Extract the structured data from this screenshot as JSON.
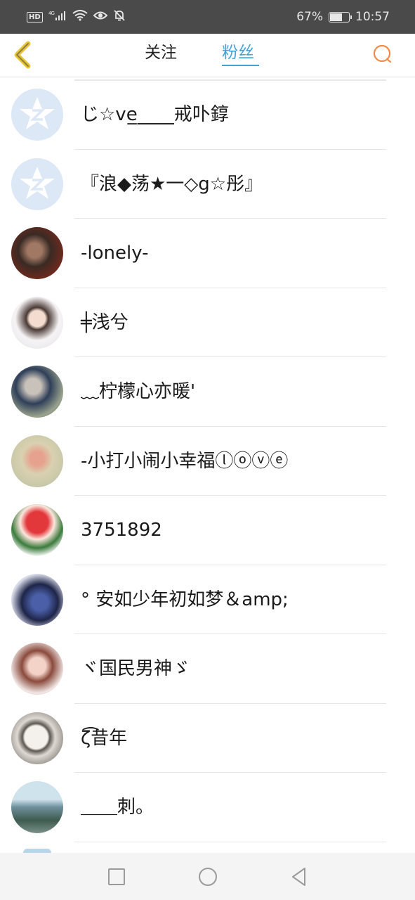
{
  "status_bar": {
    "hd": "HD",
    "network": "4G",
    "battery_percent": "67%",
    "battery_level": 0.67,
    "time": "10:57"
  },
  "header": {
    "tabs": [
      {
        "label": "关注",
        "active": false
      },
      {
        "label": "粉丝",
        "active": true
      }
    ],
    "accent_color": "#3fa3d6",
    "back_color": "#e8c63a",
    "search_color": "#f08a4b"
  },
  "fans": [
    {
      "name": "じ☆ve̲_̲_̲_̲_̲戒卟錞",
      "avatar": "default-avatar-icon"
    },
    {
      "name": "『浪◆荡★一◇g☆彤』",
      "avatar": "default-avatar-icon"
    },
    {
      "name": "-lonely-",
      "avatar": "photo"
    },
    {
      "name": "╪浅兮",
      "avatar": "photo"
    },
    {
      "name": "﹏柠檬心亦暖'",
      "avatar": "photo"
    },
    {
      "name": "-小打小闹小幸福ⓛⓞⓥⓔ",
      "avatar": "photo"
    },
    {
      "name": "3751892",
      "avatar": "photo"
    },
    {
      "name": "° 安如少年初如梦＆amp;",
      "avatar": "photo"
    },
    {
      "name": "ヾ国民男神ゞ",
      "avatar": "photo"
    },
    {
      "name": "ζ͡昔年",
      "avatar": "photo"
    },
    {
      "name": "＿＿刺。",
      "avatar": "photo"
    }
  ]
}
